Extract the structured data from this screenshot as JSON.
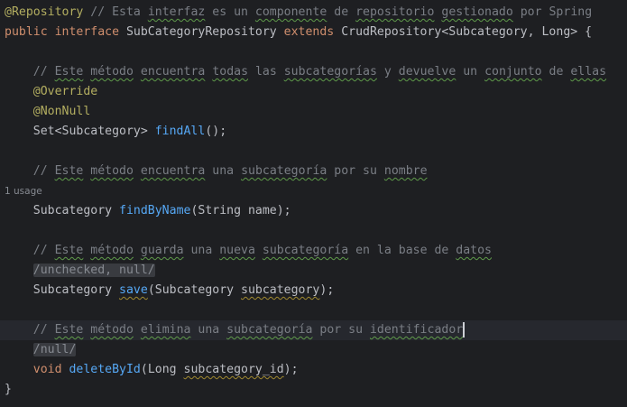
{
  "editor": {
    "colors": {
      "background": "#1e1f22",
      "keyword": "#cf8e6d",
      "annotation": "#b3ae60",
      "comment": "#7a7e85",
      "method": "#56a8f5",
      "text": "#bcbec4"
    },
    "lines": [
      {
        "tokens": [
          {
            "t": "@Repository",
            "c": "ann"
          },
          {
            "t": " // Esta ",
            "c": "cm"
          },
          {
            "t": "interfaz",
            "c": "cm typo"
          },
          {
            "t": " es un ",
            "c": "cm"
          },
          {
            "t": "componente",
            "c": "cm typo"
          },
          {
            "t": " de ",
            "c": "cm"
          },
          {
            "t": "repositorio",
            "c": "cm typo"
          },
          {
            "t": " ",
            "c": "cm"
          },
          {
            "t": "gestionado",
            "c": "cm typo"
          },
          {
            "t": " por Spring",
            "c": "cm"
          }
        ]
      },
      {
        "tokens": [
          {
            "t": "public interface ",
            "c": "kw"
          },
          {
            "t": "SubCategoryRepository ",
            "c": "pl"
          },
          {
            "t": "extends ",
            "c": "kw"
          },
          {
            "t": "CrudRepository<Subcategory, Long> {",
            "c": "pl"
          }
        ]
      },
      {
        "tokens": []
      },
      {
        "tokens": [
          {
            "t": "    // ",
            "c": "cm"
          },
          {
            "t": "Este",
            "c": "cm typo"
          },
          {
            "t": " ",
            "c": "cm"
          },
          {
            "t": "método",
            "c": "cm typo"
          },
          {
            "t": " ",
            "c": "cm"
          },
          {
            "t": "encuentra",
            "c": "cm typo"
          },
          {
            "t": " ",
            "c": "cm"
          },
          {
            "t": "todas",
            "c": "cm typo"
          },
          {
            "t": " las ",
            "c": "cm"
          },
          {
            "t": "subcategorías",
            "c": "cm typo"
          },
          {
            "t": " y ",
            "c": "cm"
          },
          {
            "t": "devuelve",
            "c": "cm typo"
          },
          {
            "t": " un ",
            "c": "cm"
          },
          {
            "t": "conjunto",
            "c": "cm typo"
          },
          {
            "t": " de ",
            "c": "cm"
          },
          {
            "t": "ellas",
            "c": "cm typo"
          }
        ]
      },
      {
        "tokens": [
          {
            "t": "    @Override",
            "c": "ann"
          }
        ]
      },
      {
        "tokens": [
          {
            "t": "    @NonNull",
            "c": "ann"
          }
        ]
      },
      {
        "tokens": [
          {
            "t": "    Set<Subcategory> ",
            "c": "pl"
          },
          {
            "t": "findAll",
            "c": "fn"
          },
          {
            "t": "();",
            "c": "pl"
          }
        ]
      },
      {
        "tokens": []
      },
      {
        "tokens": [
          {
            "t": "    // ",
            "c": "cm"
          },
          {
            "t": "Este",
            "c": "cm typo"
          },
          {
            "t": " ",
            "c": "cm"
          },
          {
            "t": "método",
            "c": "cm typo"
          },
          {
            "t": " ",
            "c": "cm"
          },
          {
            "t": "encuentra",
            "c": "cm typo"
          },
          {
            "t": " una ",
            "c": "cm"
          },
          {
            "t": "subcategoría",
            "c": "cm typo"
          },
          {
            "t": " por su ",
            "c": "cm"
          },
          {
            "t": "nombre",
            "c": "cm typo"
          }
        ]
      },
      {
        "small": true,
        "tokens": [
          {
            "t": "1 usage",
            "c": ""
          }
        ]
      },
      {
        "tokens": [
          {
            "t": "    Subcategory ",
            "c": "pl"
          },
          {
            "t": "findByName",
            "c": "fn"
          },
          {
            "t": "(String name);",
            "c": "pl"
          }
        ]
      },
      {
        "tokens": []
      },
      {
        "tokens": [
          {
            "t": "    // ",
            "c": "cm"
          },
          {
            "t": "Este",
            "c": "cm typo"
          },
          {
            "t": " ",
            "c": "cm"
          },
          {
            "t": "método",
            "c": "cm typo"
          },
          {
            "t": " ",
            "c": "cm"
          },
          {
            "t": "guarda",
            "c": "cm typo"
          },
          {
            "t": " una ",
            "c": "cm"
          },
          {
            "t": "nueva",
            "c": "cm typo"
          },
          {
            "t": " ",
            "c": "cm"
          },
          {
            "t": "subcategoría",
            "c": "cm typo"
          },
          {
            "t": " en la base de ",
            "c": "cm"
          },
          {
            "t": "datos",
            "c": "cm typo"
          }
        ]
      },
      {
        "tokens": [
          {
            "t": "    ",
            "c": "pl"
          },
          {
            "t": "/unchecked, null/",
            "c": "hint"
          }
        ]
      },
      {
        "tokens": [
          {
            "t": "    Subcategory ",
            "c": "pl"
          },
          {
            "t": "save",
            "c": "fn warn"
          },
          {
            "t": "(Subcategory ",
            "c": "pl"
          },
          {
            "t": "subcategory",
            "c": "pl warn"
          },
          {
            "t": ");",
            "c": "pl"
          }
        ]
      },
      {
        "tokens": []
      },
      {
        "current": true,
        "tokens": [
          {
            "t": "    // ",
            "c": "cm"
          },
          {
            "t": "Este",
            "c": "cm typo"
          },
          {
            "t": " ",
            "c": "cm"
          },
          {
            "t": "método",
            "c": "cm typo"
          },
          {
            "t": " ",
            "c": "cm"
          },
          {
            "t": "elimina",
            "c": "cm typo"
          },
          {
            "t": " una ",
            "c": "cm"
          },
          {
            "t": "subcategoría",
            "c": "cm typo"
          },
          {
            "t": " por su ",
            "c": "cm"
          },
          {
            "t": "identificador",
            "c": "cm typo"
          }
        ]
      },
      {
        "tokens": [
          {
            "t": "    ",
            "c": "pl"
          },
          {
            "t": "/null/",
            "c": "hint"
          }
        ]
      },
      {
        "tokens": [
          {
            "t": "    void ",
            "c": "kw"
          },
          {
            "t": "deleteById",
            "c": "fn"
          },
          {
            "t": "(Long ",
            "c": "pl"
          },
          {
            "t": "subcategory_id",
            "c": "pl warn"
          },
          {
            "t": ");",
            "c": "pl"
          }
        ]
      },
      {
        "tokens": [
          {
            "t": "}",
            "c": "pl"
          }
        ]
      }
    ]
  }
}
